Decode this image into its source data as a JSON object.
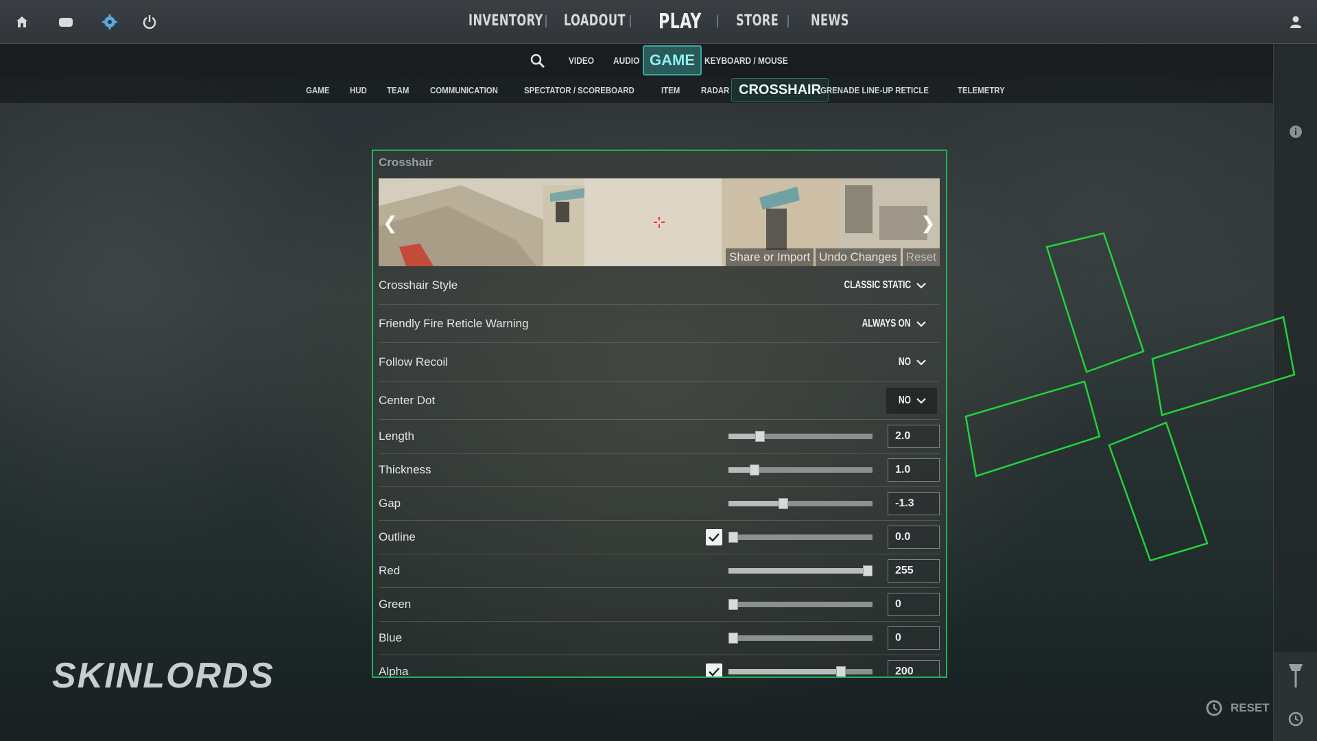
{
  "topbar": {
    "left_icons": [
      "home-icon",
      "inventory-case-icon",
      "settings-gear-icon",
      "power-icon"
    ],
    "nav": {
      "inventory": "INVENTORY",
      "loadout": "LOADOUT",
      "play": "PLAY",
      "store": "STORE",
      "news": "NEWS"
    },
    "right_icon": "profile-icon"
  },
  "subnav": {
    "video": "VIDEO",
    "audio": "AUDIO",
    "game": "GAME",
    "keyboard_mouse": "KEYBOARD / MOUSE"
  },
  "catnav": {
    "game": "GAME",
    "hud": "HUD",
    "team": "TEAM",
    "communication": "COMMUNICATION",
    "spectator": "SPECTATOR / SCOREBOARD",
    "item": "ITEM",
    "radar": "RADAR",
    "crosshair": "CROSSHAIR",
    "grenade": "GRENADE LINE-UP RETICLE",
    "telemetry": "TELEMETRY"
  },
  "panel": {
    "title": "Crosshair",
    "preview_buttons": {
      "share": "Share or Import",
      "undo": "Undo Changes",
      "reset": "Reset"
    },
    "dropdown_rows": [
      {
        "label": "Crosshair Style",
        "value": "CLASSIC STATIC"
      },
      {
        "label": "Friendly Fire Reticle Warning",
        "value": "ALWAYS ON"
      },
      {
        "label": "Follow Recoil",
        "value": "NO"
      },
      {
        "label": "Center Dot",
        "value": "NO"
      }
    ],
    "slider_rows": [
      {
        "label": "Length",
        "value": "2.0",
        "fraction": 0.22
      },
      {
        "label": "Thickness",
        "value": "1.0",
        "fraction": 0.18
      },
      {
        "label": "Gap",
        "value": "-1.3",
        "fraction": 0.38
      },
      {
        "label": "Outline",
        "value": "0.0",
        "fraction": 0.0,
        "checkbox": true
      },
      {
        "label": "Red",
        "value": "255",
        "fraction": 1.0
      },
      {
        "label": "Green",
        "value": "0",
        "fraction": 0.0
      },
      {
        "label": "Blue",
        "value": "0",
        "fraction": 0.0
      },
      {
        "label": "Alpha",
        "value": "200",
        "fraction": 0.78,
        "checkbox": true
      }
    ]
  },
  "bottom": {
    "logo": "SKINLORDS",
    "reset": "RESET"
  },
  "colors": {
    "accent_green": "#22b25a",
    "active_tab": "#3aa6a0",
    "crosshair_red": "#ff2b2b"
  }
}
